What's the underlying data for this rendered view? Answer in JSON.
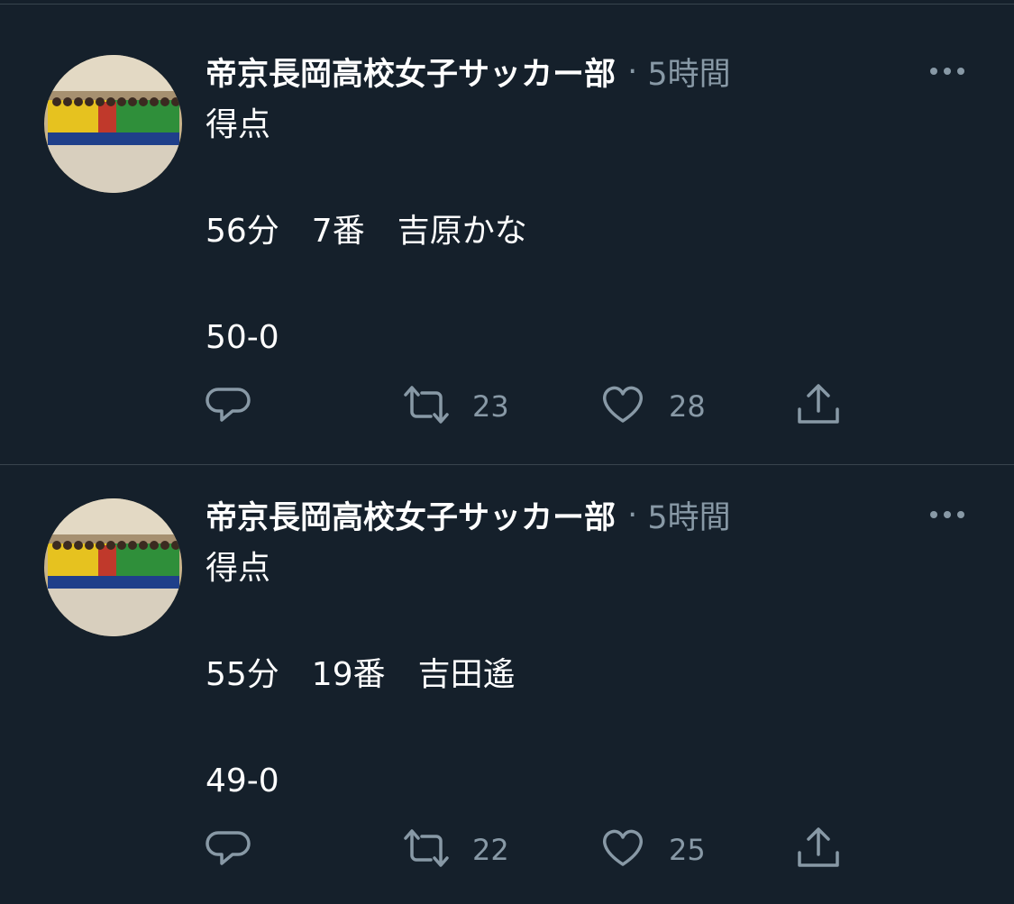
{
  "tweets": [
    {
      "display_name": "帝京長岡高校女子サッカー部",
      "separator": "·",
      "timestamp": "5時間",
      "lines": [
        "得点",
        "56分　7番　吉原かな",
        "50-0"
      ],
      "retweet_count": "23",
      "like_count": "28"
    },
    {
      "display_name": "帝京長岡高校女子サッカー部",
      "separator": "·",
      "timestamp": "5時間",
      "lines": [
        "得点",
        "55分　19番　吉田遙",
        "49-0"
      ],
      "retweet_count": "22",
      "like_count": "25"
    }
  ],
  "icons": {
    "more": "more-icon",
    "reply": "reply-icon",
    "retweet": "retweet-icon",
    "like": "like-icon",
    "share": "share-icon"
  },
  "colors": {
    "background": "#15202b",
    "text_primary": "#ffffff",
    "text_secondary": "#8899a6",
    "divider": "#38444d"
  }
}
